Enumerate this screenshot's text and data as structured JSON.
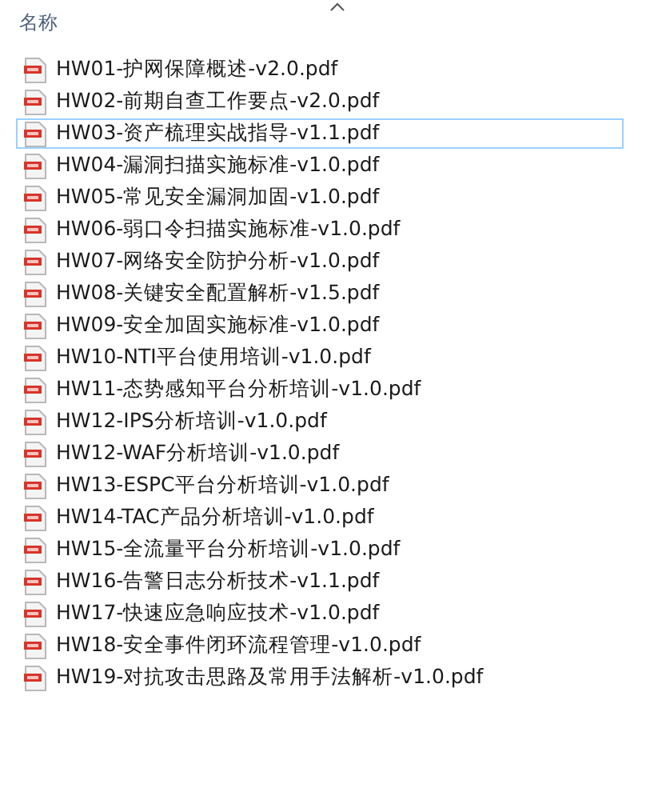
{
  "header": {
    "column_label": "名称",
    "sorted_ascending": true
  },
  "files": [
    {
      "name": "HW01-护网保障概述-v2.0.pdf",
      "focused": false
    },
    {
      "name": "HW02-前期自查工作要点-v2.0.pdf",
      "focused": false
    },
    {
      "name": "HW03-资产梳理实战指导-v1.1.pdf",
      "focused": true
    },
    {
      "name": "HW04-漏洞扫描实施标准-v1.0.pdf",
      "focused": false
    },
    {
      "name": "HW05-常见安全漏洞加固-v1.0.pdf",
      "focused": false
    },
    {
      "name": "HW06-弱口令扫描实施标准-v1.0.pdf",
      "focused": false
    },
    {
      "name": "HW07-网络安全防护分析-v1.0.pdf",
      "focused": false
    },
    {
      "name": "HW08-关键安全配置解析-v1.5.pdf",
      "focused": false
    },
    {
      "name": "HW09-安全加固实施标准-v1.0.pdf",
      "focused": false
    },
    {
      "name": "HW10-NTI平台使用培训-v1.0.pdf",
      "focused": false
    },
    {
      "name": "HW11-态势感知平台分析培训-v1.0.pdf",
      "focused": false
    },
    {
      "name": "HW12-IPS分析培训-v1.0.pdf",
      "focused": false
    },
    {
      "name": "HW12-WAF分析培训-v1.0.pdf",
      "focused": false
    },
    {
      "name": "HW13-ESPC平台分析培训-v1.0.pdf",
      "focused": false
    },
    {
      "name": "HW14-TAC产品分析培训-v1.0.pdf",
      "focused": false
    },
    {
      "name": "HW15-全流量平台分析培训-v1.0.pdf",
      "focused": false
    },
    {
      "name": "HW16-告警日志分析技术-v1.1.pdf",
      "focused": false
    },
    {
      "name": "HW17-快速应急响应技术-v1.0.pdf",
      "focused": false
    },
    {
      "name": "HW18-安全事件闭环流程管理-v1.0.pdf",
      "focused": false
    },
    {
      "name": "HW19-对抗攻击思路及常用手法解析-v1.0.pdf",
      "focused": false
    }
  ]
}
